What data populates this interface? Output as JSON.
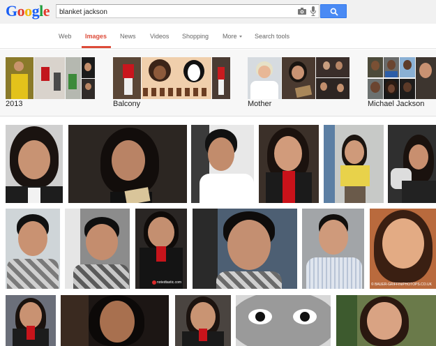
{
  "header": {
    "logo_letters": [
      "G",
      "o",
      "o",
      "g",
      "l",
      "e"
    ],
    "logo_colors": [
      "#1a5ff5",
      "#e33a2a",
      "#f2b805",
      "#1a5ff5",
      "#1e9c3c",
      "#e33a2a"
    ],
    "search_value": "blanket jackson",
    "search_button_color": "#4a8af4"
  },
  "tabs": {
    "web": "Web",
    "images": "Images",
    "news": "News",
    "videos": "Videos",
    "shopping": "Shopping",
    "more": "More",
    "search_tools": "Search tools",
    "active": "Images",
    "active_color": "#dd4b39"
  },
  "related": {
    "items": [
      {
        "label": "2013"
      },
      {
        "label": "Balcony"
      },
      {
        "label": "Mother"
      },
      {
        "label": "Michael Jackson"
      }
    ]
  },
  "watermarks": {
    "w1": "notedtastic.com",
    "w2": "© BAUER-GRIFFIN/PHOTOPS.CO.UK"
  }
}
